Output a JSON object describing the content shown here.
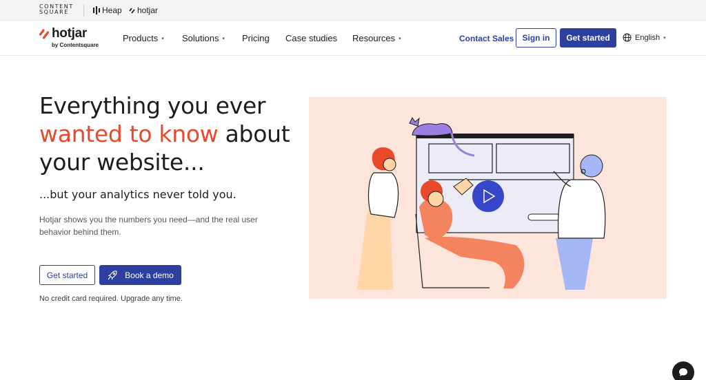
{
  "brand_strip": {
    "contentsquare_line1": "CONTENT",
    "contentsquare_line2": "SQUARE",
    "heap": "Heap",
    "hotjar": "hotjar"
  },
  "nav": {
    "logo_text": "hotjar",
    "logo_sub": "by Contentsquare",
    "items": [
      {
        "label": "Products",
        "has_caret": true
      },
      {
        "label": "Solutions",
        "has_caret": true
      },
      {
        "label": "Pricing",
        "has_caret": false
      },
      {
        "label": "Case studies",
        "has_caret": false
      },
      {
        "label": "Resources",
        "has_caret": true
      }
    ],
    "contact_sales": "Contact Sales",
    "sign_in": "Sign in",
    "get_started": "Get started",
    "language": "English"
  },
  "hero": {
    "title_line1": "Everything you ever",
    "title_accent": "wanted to know",
    "title_after_accent": " about",
    "title_line3": "your website...",
    "subtitle": "...but your analytics never told you.",
    "description": "Hotjar shows you the numbers you need—and the real user behavior behind them.",
    "get_started": "Get started",
    "book_demo": "Book a demo",
    "note": "No credit card required. Upgrade any time."
  },
  "colors": {
    "brand_blue": "#2d3f9f",
    "accent_orange": "#e8492a",
    "illustration_bg": "#fde5dc"
  },
  "icons": [
    "hotjar-logo-icon",
    "globe-icon",
    "rocket-icon",
    "play-icon",
    "chat-icon"
  ]
}
